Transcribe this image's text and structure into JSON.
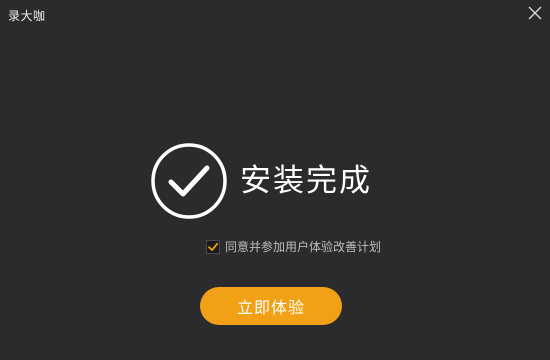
{
  "window": {
    "title": "录大咖",
    "close_icon": "close-icon"
  },
  "result": {
    "icon": "check-circle-icon",
    "status_text": "安装完成"
  },
  "consent": {
    "checked": true,
    "label": "同意并参加用户体验改善计划"
  },
  "actions": {
    "primary_label": "立即体验"
  },
  "colors": {
    "background": "#2b2b2d",
    "accent": "#f2a116",
    "text": "#ffffff"
  }
}
